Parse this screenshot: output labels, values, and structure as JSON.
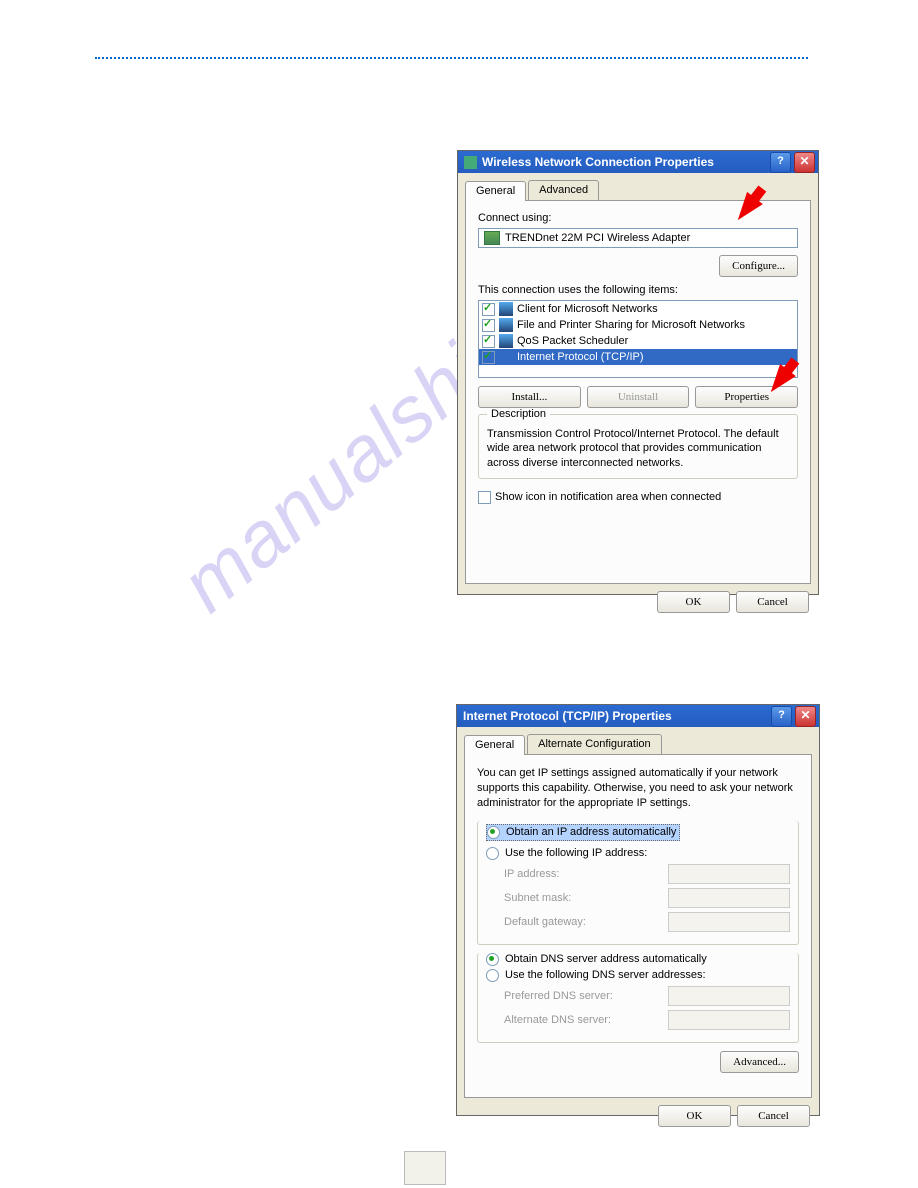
{
  "watermark": "manualshive.com",
  "dialog1": {
    "title": "Wireless Network Connection Properties",
    "tabs": [
      "General",
      "Advanced"
    ],
    "connect_using_label": "Connect using:",
    "adapter": "TRENDnet 22M PCI Wireless Adapter",
    "configure": "Configure...",
    "items_label": "This connection uses the following items:",
    "items": [
      "Client for Microsoft Networks",
      "File and Printer Sharing for Microsoft Networks",
      "QoS Packet Scheduler",
      "Internet Protocol (TCP/IP)"
    ],
    "install": "Install...",
    "uninstall": "Uninstall",
    "properties": "Properties",
    "desc_legend": "Description",
    "desc_text": "Transmission Control Protocol/Internet Protocol. The default wide area network protocol that provides communication across diverse interconnected networks.",
    "show_icon": "Show icon in notification area when connected",
    "ok": "OK",
    "cancel": "Cancel"
  },
  "dialog2": {
    "title": "Internet Protocol (TCP/IP) Properties",
    "tabs": [
      "General",
      "Alternate Configuration"
    ],
    "intro": "You can get IP settings assigned automatically if your network supports this capability. Otherwise, you need to ask your network administrator for the appropriate IP settings.",
    "obtain_ip": "Obtain an IP address automatically",
    "use_ip": "Use the following IP address:",
    "ip_address": "IP address:",
    "subnet": "Subnet mask:",
    "gateway": "Default gateway:",
    "obtain_dns": "Obtain DNS server address automatically",
    "use_dns": "Use the following DNS server addresses:",
    "pref_dns": "Preferred DNS server:",
    "alt_dns": "Alternate DNS server:",
    "advanced": "Advanced...",
    "ok": "OK",
    "cancel": "Cancel"
  }
}
